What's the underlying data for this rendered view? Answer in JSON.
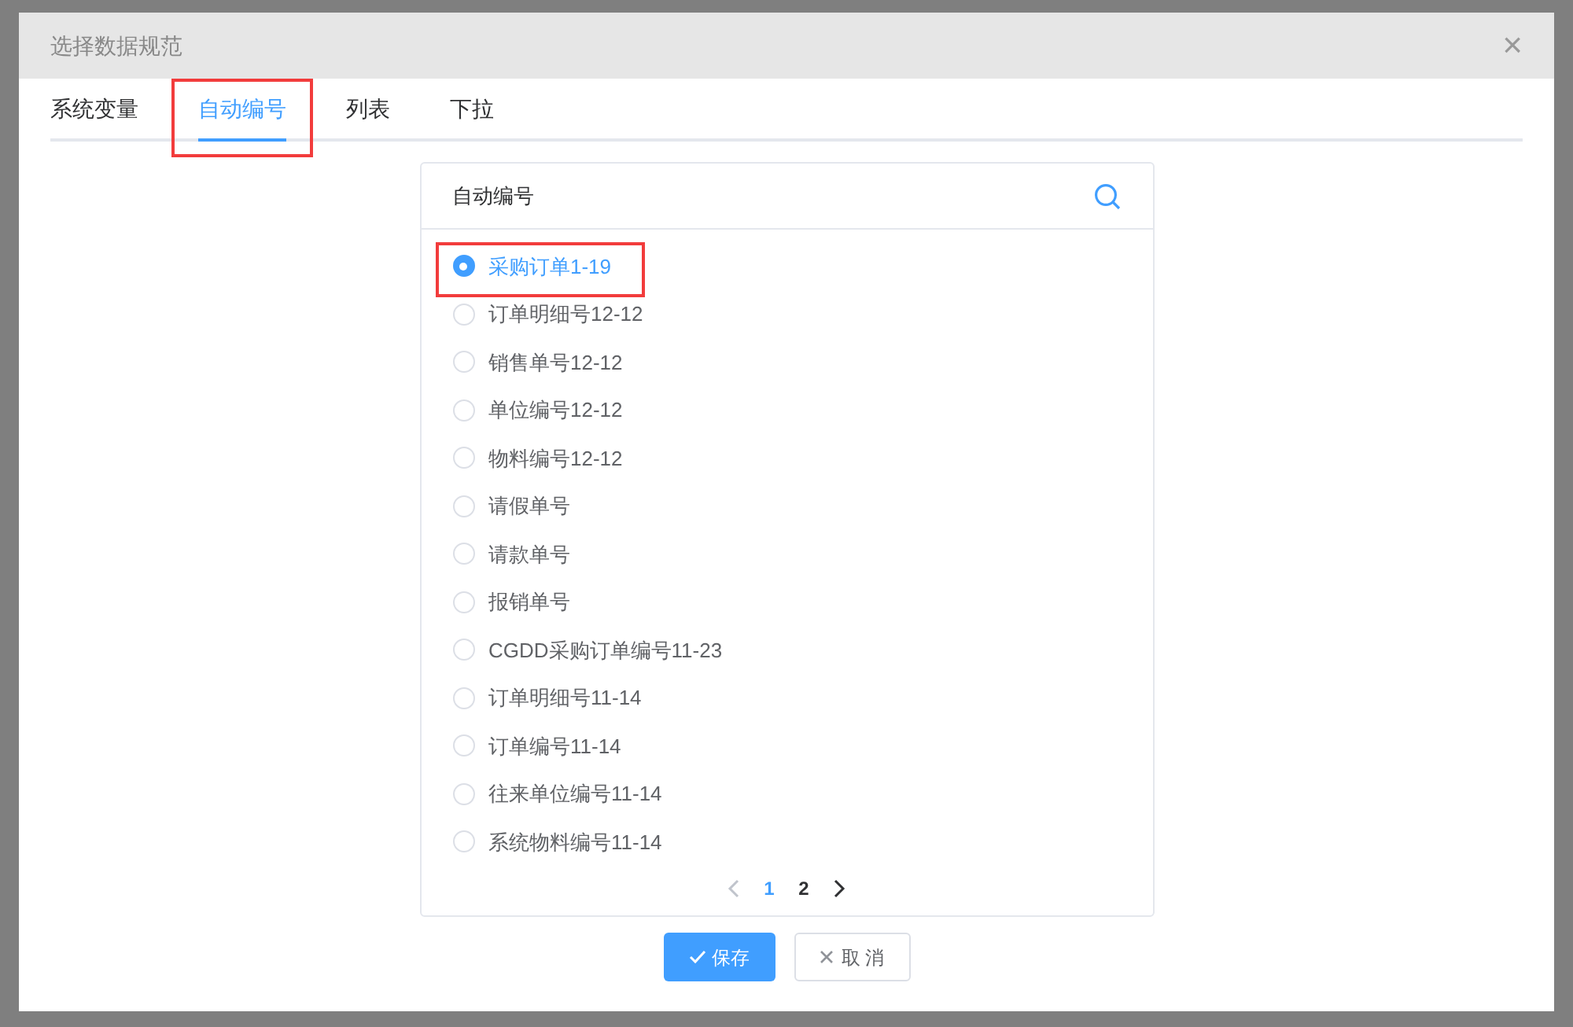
{
  "dialog": {
    "title": "选择数据规范",
    "close": "×"
  },
  "tabs": [
    {
      "label": "系统变量",
      "selected": false,
      "highlighted": false
    },
    {
      "label": "自动编号",
      "selected": true,
      "highlighted": true
    },
    {
      "label": "列表",
      "selected": false,
      "highlighted": false
    },
    {
      "label": "下拉",
      "selected": false,
      "highlighted": false
    }
  ],
  "panel": {
    "title": "自动编号",
    "items": [
      {
        "label": "采购订单1-19",
        "selected": true,
        "highlighted": true
      },
      {
        "label": "订单明细号12-12",
        "selected": false,
        "highlighted": false
      },
      {
        "label": "销售单号12-12",
        "selected": false,
        "highlighted": false
      },
      {
        "label": "单位编号12-12",
        "selected": false,
        "highlighted": false
      },
      {
        "label": "物料编号12-12",
        "selected": false,
        "highlighted": false
      },
      {
        "label": "请假单号",
        "selected": false,
        "highlighted": false
      },
      {
        "label": "请款单号",
        "selected": false,
        "highlighted": false
      },
      {
        "label": "报销单号",
        "selected": false,
        "highlighted": false
      },
      {
        "label": "CGDD采购订单编号11-23",
        "selected": false,
        "highlighted": false
      },
      {
        "label": "订单明细号11-14",
        "selected": false,
        "highlighted": false
      },
      {
        "label": "订单编号11-14",
        "selected": false,
        "highlighted": false
      },
      {
        "label": "往来单位编号11-14",
        "selected": false,
        "highlighted": false
      },
      {
        "label": "系统物料编号11-14",
        "selected": false,
        "highlighted": false
      }
    ],
    "pages": [
      {
        "label": "1",
        "selected": true
      },
      {
        "label": "2",
        "selected": false
      }
    ]
  },
  "buttons": [
    {
      "kind": "primary",
      "label": "保存"
    },
    {
      "kind": "secondary",
      "label": "取 消"
    }
  ]
}
